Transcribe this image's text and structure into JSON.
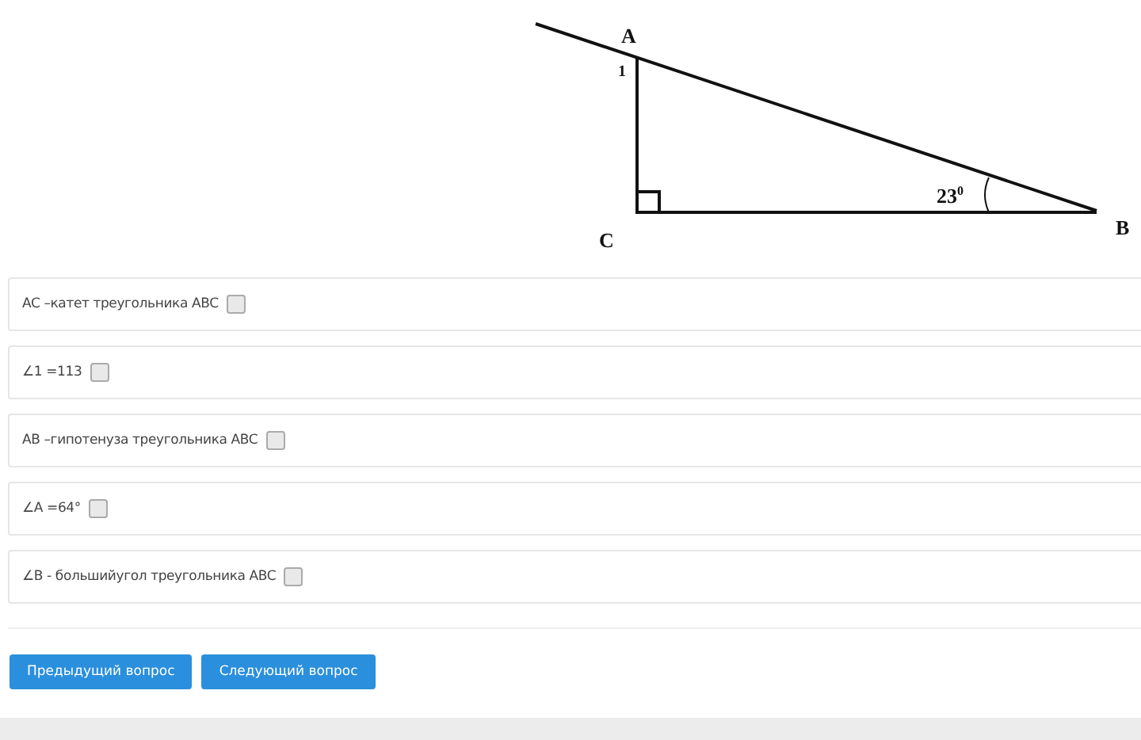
{
  "figure": {
    "labels": [
      {
        "text": "A"
      },
      {
        "text": "1"
      },
      {
        "text": "C"
      },
      {
        "text": "B"
      },
      {
        "text": "23",
        "superscript": "0"
      }
    ]
  },
  "options": [
    {
      "text": "AC –катет треугольника ABC",
      "checked": false
    },
    {
      "text": "∠1 =113",
      "checked": false
    },
    {
      "text": "AB –гипотенуза треугольника ABC",
      "checked": false
    },
    {
      "text": "∠A =64°",
      "checked": false
    },
    {
      "text": "∠B - большийугол треугольника ABC",
      "checked": false
    }
  ],
  "buttons": [
    {
      "label": "Предыдущий вопрос"
    },
    {
      "label": "Следующий вопрос"
    }
  ]
}
